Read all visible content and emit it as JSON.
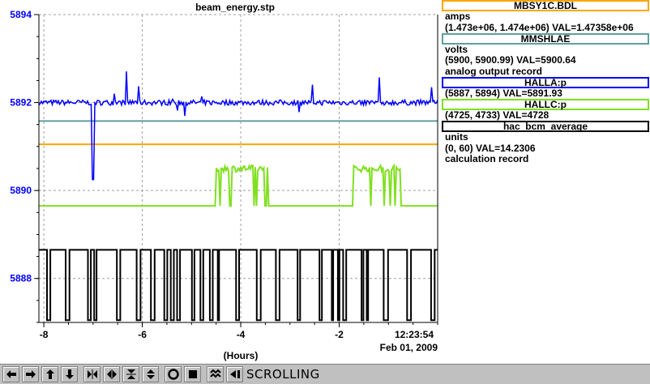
{
  "plot": {
    "title": "beam_energy.stp",
    "xlabel": "(Hours)",
    "time_label": "12:23:54",
    "date_label": "Feb 01, 2009",
    "y_ticks": [
      "5894",
      "5892",
      "5890",
      "5888"
    ],
    "x_ticks": [
      "-8",
      "-6",
      "-4",
      "-2"
    ]
  },
  "chart_data": {
    "type": "line",
    "title": "beam_energy.stp",
    "xlabel": "(Hours)",
    "ylabel": "",
    "xlim": [
      -8.1,
      0
    ],
    "ylim": [
      5887.0,
      5894.0
    ],
    "grid": true,
    "x_ticks": [
      -8,
      -6,
      -4,
      -2
    ],
    "y_ticks": [
      5894,
      5892,
      5890,
      5888
    ],
    "series": [
      {
        "name": "MBSY1C.BDL",
        "color": "#ffa500",
        "style": "flat",
        "level": 5891.05
      },
      {
        "name": "MMSHLAE",
        "color": "#5f9ea0",
        "style": "flat",
        "level": 5891.58
      },
      {
        "name": "HALLA:p",
        "color": "#0000ff",
        "style": "noisy",
        "level": 5892.0
      },
      {
        "name": "HALLC:p",
        "color": "#80e020",
        "style": "steps",
        "base": 5889.65,
        "high_segments": [
          [
            -4.5,
            -3.45
          ],
          [
            -1.75,
            -0.75
          ]
        ],
        "high_level": 5890.5
      },
      {
        "name": "hac_bcm_average",
        "color": "#000000",
        "style": "square",
        "high": 5888.65,
        "low": 5887.05
      }
    ]
  },
  "legend": {
    "traces": [
      {
        "name": "MBSY1C.BDL",
        "color": "#ffa500",
        "lines": [
          "amps",
          "(1.473e+06, 1.474e+06)  VAL=1.47358e+06"
        ]
      },
      {
        "name": "MMSHLAE",
        "color": "#5f9ea0",
        "lines": [
          "volts",
          "(5900, 5900.99)  VAL=5900.64",
          "analog output record"
        ]
      },
      {
        "name": "HALLA:p",
        "color": "#0000ff",
        "lines": [
          "(5887, 5894) VAL=5891.93"
        ]
      },
      {
        "name": "HALLC:p",
        "color": "#80e020",
        "lines": [
          "(4725, 4733) VAL=4728"
        ]
      },
      {
        "name": "hac_bcm_average",
        "color": "#000000",
        "lines": [
          "units",
          "(0, 60) VAL=14.2306",
          "calculation record"
        ]
      }
    ]
  },
  "toolbar": {
    "status_label": "SCROLLING",
    "buttons": [
      "arrow-left-icon",
      "arrow-right-icon",
      "arrow-up-icon",
      "arrow-down-icon",
      "zoom-in-horizontal-icon",
      "zoom-out-horizontal-icon",
      "zoom-in-vertical-icon",
      "zoom-out-vertical-icon",
      "record-icon",
      "stop-icon",
      "autoscale-icon",
      "back-icon"
    ]
  }
}
